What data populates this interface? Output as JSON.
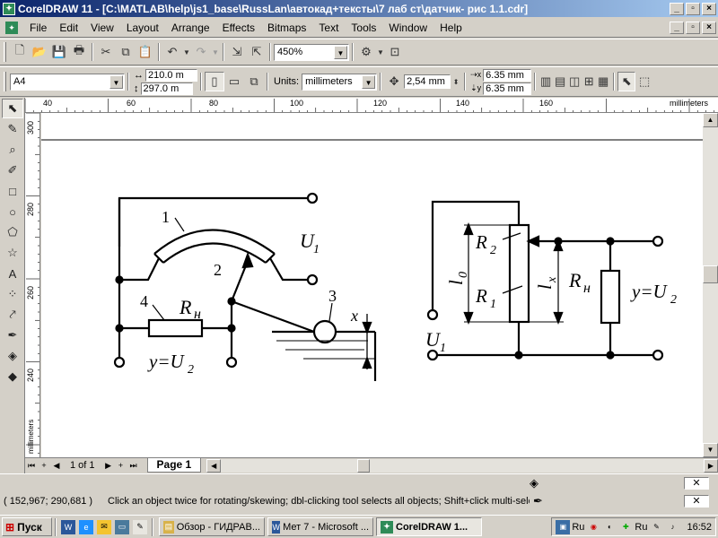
{
  "window": {
    "title": "CorelDRAW 11 - [C:\\MATLAB\\help\\js1_base\\RussLan\\автокад+тексты\\7 лаб ст\\датчик- рис 1.1.cdr]",
    "app_icon": "coreldraw-icon",
    "buttons": [
      "_",
      "▫",
      "×"
    ]
  },
  "menu": {
    "items": [
      "File",
      "Edit",
      "View",
      "Layout",
      "Arrange",
      "Effects",
      "Bitmaps",
      "Text",
      "Tools",
      "Window",
      "Help"
    ]
  },
  "standard_toolbar": {
    "zoom_value": "450%",
    "icons": [
      "new-icon",
      "open-icon",
      "save-icon",
      "print-icon",
      "cut-icon",
      "copy-icon",
      "paste-icon",
      "undo-icon",
      "redo-icon",
      "import-icon",
      "export-icon",
      "app-launcher-icon"
    ]
  },
  "property_bar": {
    "paper_size": "A4",
    "width": "210.0 m",
    "height": "297.0 m",
    "units_label": "Units:",
    "units_value": "millimeters",
    "nudge": "2,54 mm",
    "dup_x": "6.35 mm",
    "dup_y": "6.35 mm"
  },
  "rulers": {
    "unit_label": "millimeters",
    "h_ticks": [
      "40",
      "60",
      "80",
      "100",
      "120",
      "140",
      "160"
    ],
    "v_ticks": [
      "300",
      "280",
      "260",
      "240"
    ]
  },
  "drawing": {
    "left": {
      "label_1": "1",
      "label_2": "2",
      "label_3": "3",
      "label_4": "4",
      "label_u1": "U",
      "label_u1_sub": "1",
      "label_rn": "R",
      "label_rn_sub": "н",
      "label_x": "x",
      "label_y": "y=U",
      "label_y_sub": "2"
    },
    "right": {
      "label_r2": "R",
      "label_r2_sub": "2",
      "label_r1": "R",
      "label_r1_sub": "1",
      "label_l0": "l",
      "label_l0_sub": "0",
      "label_lx": "l",
      "label_lx_sub": "x",
      "label_rn": "R",
      "label_rn_sub": "н",
      "label_y": "y=U",
      "label_y_sub": "2",
      "label_u1": "U",
      "label_u1_sub": "1"
    }
  },
  "page_tabs": {
    "counter": "1 of 1",
    "active_tab": "Page 1"
  },
  "status": {
    "coords": "( 152,967; 290,681 )",
    "hint": "Click an object twice for rotating/skewing; dbl-clicking tool selects all objects; Shift+click multi-sele..."
  },
  "taskbar": {
    "start_label": "Пуск",
    "tasks": [
      {
        "label": "Обзор - ГИДРАВ...",
        "icon": "explorer-icon",
        "active": false
      },
      {
        "label": "Мет 7 - Microsoft ...",
        "icon": "word-icon",
        "active": false
      },
      {
        "label": "CorelDRAW 1...",
        "icon": "coreldraw-icon",
        "active": true
      }
    ],
    "lang": "Ru",
    "lang2": "Ru",
    "clock": "16:52"
  },
  "colors": {
    "title_start": "#0a246a",
    "title_end": "#a6caf0",
    "chrome": "#d4d0c8"
  }
}
